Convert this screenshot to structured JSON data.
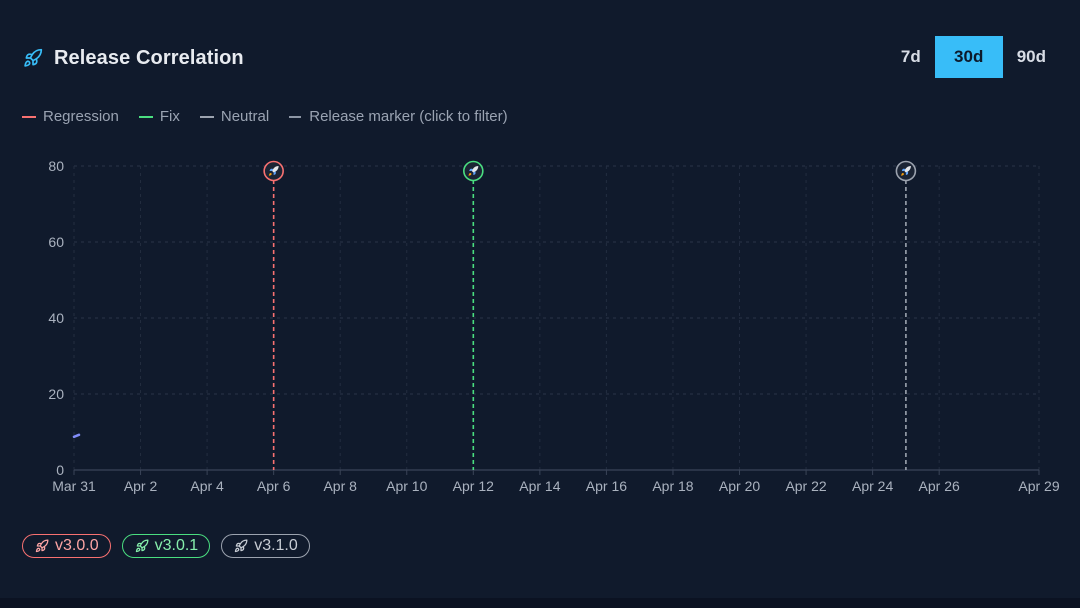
{
  "header": {
    "title": "Release Correlation",
    "icon": "rocket-icon"
  },
  "range": {
    "options": [
      "7d",
      "30d",
      "90d"
    ],
    "selected": "30d"
  },
  "legend": {
    "regression": "Regression",
    "fix": "Fix",
    "neutral": "Neutral",
    "marker": "Release marker (click to filter)"
  },
  "colors": {
    "regression": "#f87171",
    "fix": "#4ade80",
    "neutral": "#9ca3af",
    "accent": "#38bdf8",
    "series": "#818cf8"
  },
  "chart_data": {
    "type": "line",
    "x_ticks": [
      "Mar 31",
      "Apr 2",
      "Apr 4",
      "Apr 6",
      "Apr 8",
      "Apr 10",
      "Apr 12",
      "Apr 14",
      "Apr 16",
      "Apr 18",
      "Apr 20",
      "Apr 22",
      "Apr 24",
      "Apr 26",
      "Apr 29"
    ],
    "x_range": [
      "Mar 31",
      "Apr 29"
    ],
    "y_ticks": [
      0,
      20,
      40,
      60,
      80
    ],
    "ylim": [
      0,
      80
    ],
    "grid": true,
    "series": [
      {
        "points": [
          {
            "x": "Mar 31",
            "y": 9
          }
        ]
      }
    ],
    "release_markers": [
      {
        "x": "Apr 6",
        "version": "v3.0.0",
        "kind": "regression"
      },
      {
        "x": "Apr 12",
        "version": "v3.0.1",
        "kind": "fix"
      },
      {
        "x": "Apr 25",
        "version": "v3.1.0",
        "kind": "neutral"
      }
    ]
  },
  "releases": [
    {
      "label": "v3.0.0",
      "kind": "regression"
    },
    {
      "label": "v3.0.1",
      "kind": "fix"
    },
    {
      "label": "v3.1.0",
      "kind": "neutral"
    }
  ]
}
